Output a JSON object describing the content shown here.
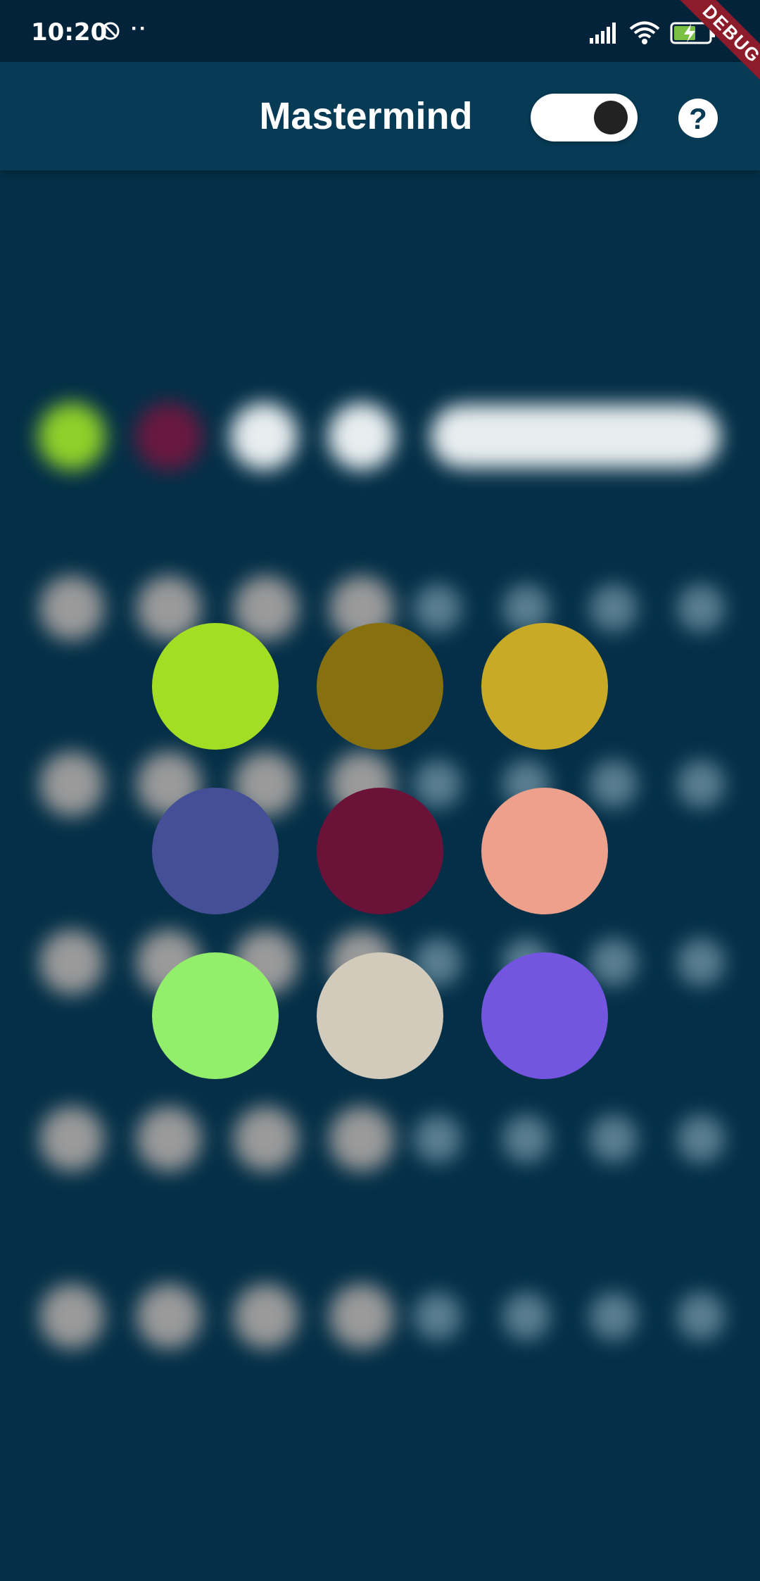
{
  "status_bar": {
    "time": "10:20",
    "dots": "··",
    "icons": [
      "do-not-disturb-icon",
      "signal-icon",
      "wifi-icon",
      "battery-charging-icon"
    ]
  },
  "app_bar": {
    "title": "Mastermind",
    "toggle_on": true,
    "help_label": "?"
  },
  "debug_banner": "DEBUG",
  "board": {
    "secret_row_colors": [
      "#8fd12a",
      "#6a1840",
      "#e8eef0",
      "#e8eef0"
    ],
    "guess_rows": 5,
    "pegs_per_row": 4,
    "peg_color": "#9a9a9a",
    "hint_color": "#5a7f92"
  },
  "picker": {
    "colors": [
      "#a3de24",
      "#87700f",
      "#c8aa27",
      "#444f98",
      "#6b1238",
      "#eda08b",
      "#93ef6b",
      "#d2cbbc",
      "#7355e0"
    ],
    "names": [
      "color-yellowgreen",
      "color-olive",
      "color-gold",
      "color-indigo",
      "color-maroon",
      "color-salmon",
      "color-lightgreen",
      "color-beige",
      "color-violet"
    ]
  }
}
